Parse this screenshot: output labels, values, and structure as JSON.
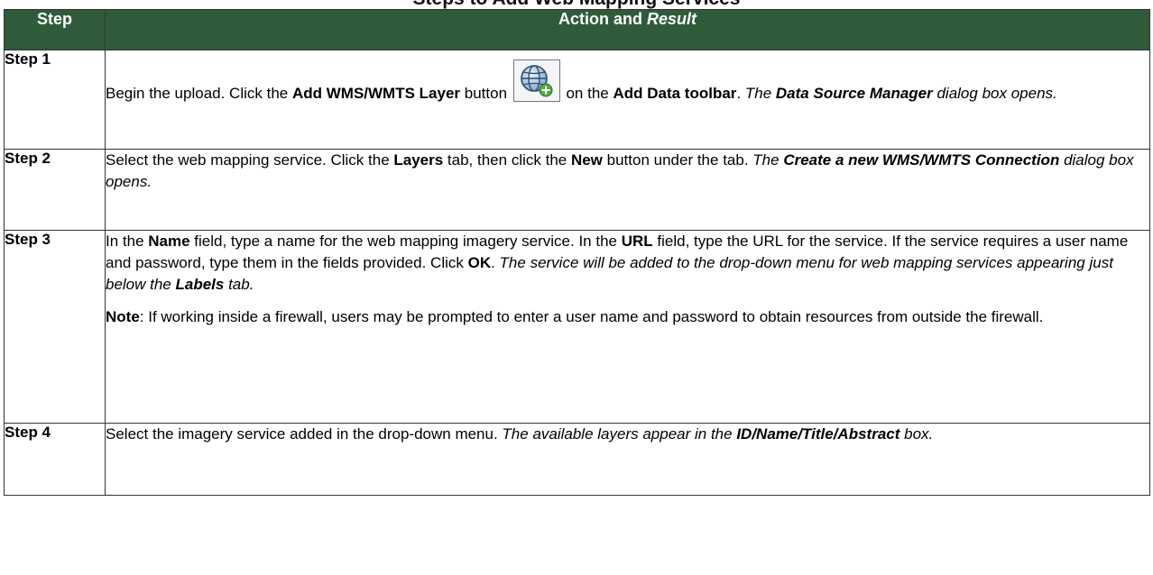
{
  "caption_fragment": "Steps to Add Web Mapping Services",
  "table": {
    "header": {
      "step": "Step",
      "action_plain": "Action and ",
      "action_italic": "Result"
    },
    "rows": [
      {
        "step": "Step 1",
        "parts": {
          "t1": "Begin the upload. Click the ",
          "b1": "Add WMS/WMTS Layer",
          "t2": " button ",
          "t3": " on the ",
          "b2": "Add Data toolbar",
          "t4": ". ",
          "i1": "The ",
          "bi1": "Data Source Manager",
          "i2": " dialog box opens."
        }
      },
      {
        "step": "Step 2",
        "parts": {
          "t1": "Select the web mapping service. Click the ",
          "b1": "Layers",
          "t2": " tab, then click the ",
          "b2": "New",
          "t3": " button under the tab. ",
          "i1": "The ",
          "bi1": "Create a new WMS/WMTS Connection",
          "i2": " dialog box opens."
        }
      },
      {
        "step": "Step 3",
        "parts": {
          "t1": "In the ",
          "b1": "Name",
          "t2": " field, type a name for the web mapping imagery service. In the ",
          "b2": "URL",
          "t3": " field, type the URL for the service. If the service requires a user name and password, type them in the fields provided. Click ",
          "b3": "OK",
          "t4": ". ",
          "i1": "The service will be added to the drop-down menu for web mapping services appearing just below the ",
          "bi1": "Labels",
          "i2": " tab.",
          "note_b": "Note",
          "note_t": ": If working inside a firewall, users may be prompted to enter a user name and password to obtain resources from outside the firewall."
        }
      },
      {
        "step": "Step 4",
        "parts": {
          "t1": "Select the imagery service added in the drop-down menu. ",
          "i1": "The available layers appear in the ",
          "bi1": "ID/Name/Title/Abstract",
          "i2": " box."
        }
      }
    ]
  },
  "colors": {
    "header_bg": "#2f5b3a",
    "header_text": "#ffffff",
    "border": "#333333"
  },
  "icons": {
    "step1_button": "add-wms-layer-globe-icon"
  }
}
